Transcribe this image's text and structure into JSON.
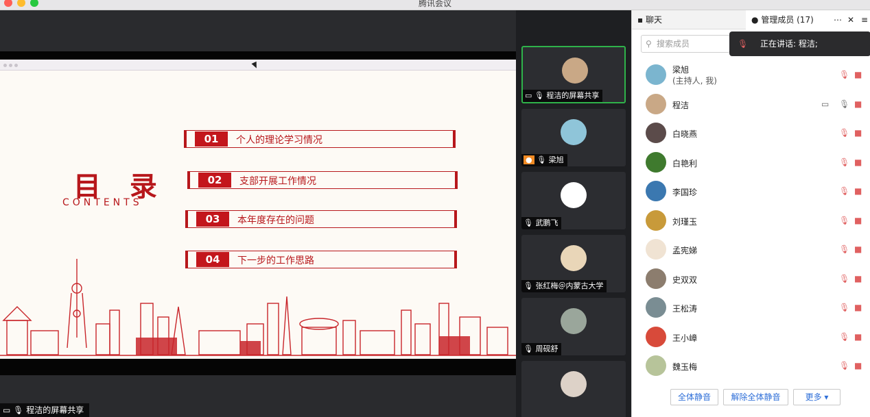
{
  "app": {
    "title": "腾讯会议"
  },
  "slide": {
    "heading": "目 录",
    "subheading": "CONTENTS",
    "items": [
      {
        "num": "01",
        "label": "个人的理论学习情况"
      },
      {
        "num": "02",
        "label": "支部开展工作情况"
      },
      {
        "num": "03",
        "label": "本年度存在的问题"
      },
      {
        "num": "04",
        "label": "下一步的工作思路"
      }
    ]
  },
  "screen_share_label": "程洁的屏幕共享",
  "video_tiles": [
    {
      "name": "程洁的屏幕共享",
      "avatar": "#c9a886"
    },
    {
      "name": "梁旭",
      "avatar": "#8fc5d9"
    },
    {
      "name": "武鹏飞",
      "avatar": "#ffffff"
    },
    {
      "name": "张红梅＠内蒙古大学",
      "avatar": "#e9d6b8"
    },
    {
      "name": "周砚舒",
      "avatar": "#9aa69b"
    },
    {
      "name": "",
      "avatar": "#ddd2c8"
    }
  ],
  "panel": {
    "chat_tab": "聊天",
    "members_tab": "管理成员 (17)",
    "search_placeholder": "搜索成员",
    "speaking_toast": "正在讲话: 程洁;",
    "members": [
      {
        "name": "梁旭",
        "role": "(主持人, 我)",
        "avatar": "#7bb5cf",
        "sharing": false
      },
      {
        "name": "程洁",
        "role": "",
        "avatar": "#c9a886",
        "sharing": true
      },
      {
        "name": "白晓燕",
        "role": "",
        "avatar": "#5b4b4a",
        "sharing": false
      },
      {
        "name": "白艳利",
        "role": "",
        "avatar": "#3f7a2e",
        "sharing": false
      },
      {
        "name": "李国珍",
        "role": "",
        "avatar": "#3b78b0",
        "sharing": false
      },
      {
        "name": "刘瑾玉",
        "role": "",
        "avatar": "#c89a3a",
        "sharing": false
      },
      {
        "name": "孟宪娣",
        "role": "",
        "avatar": "#f0e3d3",
        "sharing": false
      },
      {
        "name": "史双双",
        "role": "",
        "avatar": "#8c7d6e",
        "sharing": false
      },
      {
        "name": "王松涛",
        "role": "",
        "avatar": "#7a8d93",
        "sharing": false
      },
      {
        "name": "王小嶂",
        "role": "",
        "avatar": "#d84a3a",
        "sharing": false
      },
      {
        "name": "魏玉梅",
        "role": "",
        "avatar": "#b7c49a",
        "sharing": false
      }
    ],
    "buttons": {
      "mute_all": "全体静音",
      "unmute_all": "解除全体静音",
      "more": "更多 ▾"
    }
  },
  "colors": {
    "accent_red": "#b7171b",
    "active_green": "#2fb34a",
    "link_blue": "#2f6fd8"
  }
}
